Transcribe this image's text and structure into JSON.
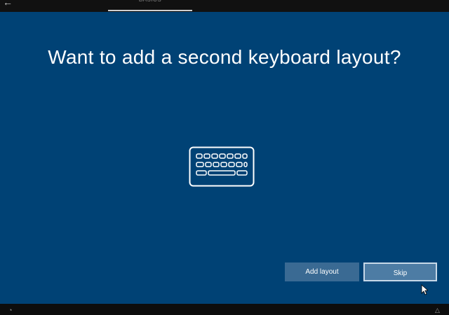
{
  "header": {
    "back_icon": "back-arrow-icon",
    "section_label": "Basics"
  },
  "main": {
    "title": "Want to add a second keyboard layout?",
    "illustration_icon": "keyboard-icon"
  },
  "actions": {
    "add_layout_label": "Add layout",
    "skip_label": "Skip"
  },
  "footer": {
    "left_icon": "ease-of-access-icon",
    "right_icon": "volume-icon"
  },
  "colors": {
    "background": "#004275",
    "primary_button": "#4d7ca4",
    "secondary_button": "#3a6a93",
    "text": "#ffffff"
  }
}
